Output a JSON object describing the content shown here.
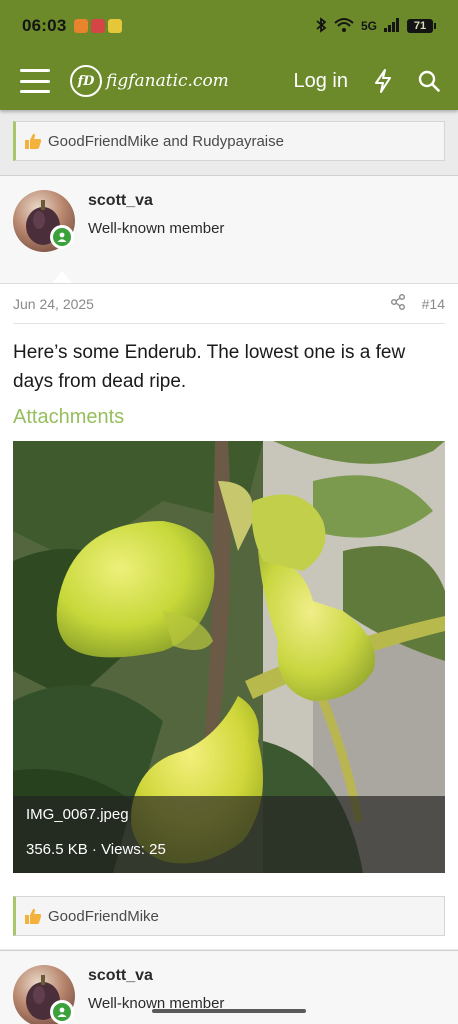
{
  "status_bar": {
    "time": "06:03",
    "network": "5G",
    "battery": "71"
  },
  "header": {
    "logo_mark": "fD",
    "logo_text": "figfanatic.com",
    "login_label": "Log in"
  },
  "reactions_top": {
    "text": "GoodFriendMike and Rudypayraise"
  },
  "post": {
    "username": "scott_va",
    "user_title": "Well-known member",
    "date": "Jun 24, 2025",
    "number": "#14",
    "body": "Here’s some Enderub. The lowest one is a few days from dead ripe.",
    "attachments_label": "Attachments",
    "attachment": {
      "filename": "IMG_0067.jpeg",
      "size": "356.5 KB",
      "views": "Views: 25"
    }
  },
  "reactions_bottom": {
    "text": "GoodFriendMike"
  },
  "next_post": {
    "username": "scott_va",
    "user_title": "Well-known member"
  },
  "colors": {
    "brand_green": "#6c8a2a",
    "accent_green": "#96be5c",
    "online_green": "#3ba23b"
  }
}
